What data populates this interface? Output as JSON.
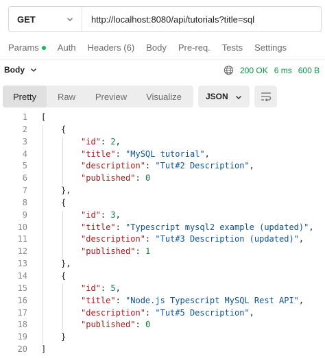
{
  "request": {
    "method": "GET",
    "url": "http://localhost:8080/api/tutorials?title=sql"
  },
  "request_tabs": [
    {
      "label": "Params",
      "indicator": true
    },
    {
      "label": "Auth"
    },
    {
      "label": "Headers (6)"
    },
    {
      "label": "Body"
    },
    {
      "label": "Pre-req."
    },
    {
      "label": "Tests"
    },
    {
      "label": "Settings"
    }
  ],
  "response": {
    "section_label": "Body",
    "status": "200 OK",
    "time": "6 ms",
    "size": "600 B"
  },
  "format_tabs": [
    "Pretty",
    "Raw",
    "Preview",
    "Visualize"
  ],
  "active_format": "Pretty",
  "language": "JSON",
  "colors": {
    "key": "#a41a1a",
    "string": "#0b5394",
    "number": "#11783f",
    "status_ok": "#0b8f47",
    "params_dot": "#0cbb52"
  },
  "json_lines": [
    {
      "n": "1",
      "indent": 0,
      "parts": [
        {
          "t": "[",
          "c": "pun"
        }
      ]
    },
    {
      "n": "2",
      "indent": 1,
      "parts": [
        {
          "t": "{",
          "c": "pun"
        }
      ]
    },
    {
      "n": "3",
      "indent": 2,
      "parts": [
        {
          "t": "\"id\"",
          "c": "key"
        },
        {
          "t": ": ",
          "c": "pun"
        },
        {
          "t": "2",
          "c": "num"
        },
        {
          "t": ",",
          "c": "pun"
        }
      ]
    },
    {
      "n": "4",
      "indent": 2,
      "parts": [
        {
          "t": "\"title\"",
          "c": "key"
        },
        {
          "t": ": ",
          "c": "pun"
        },
        {
          "t": "\"MySQL tutorial\"",
          "c": "str"
        },
        {
          "t": ",",
          "c": "pun"
        }
      ]
    },
    {
      "n": "5",
      "indent": 2,
      "parts": [
        {
          "t": "\"description\"",
          "c": "key"
        },
        {
          "t": ": ",
          "c": "pun"
        },
        {
          "t": "\"Tut#2 Description\"",
          "c": "str"
        },
        {
          "t": ",",
          "c": "pun"
        }
      ]
    },
    {
      "n": "6",
      "indent": 2,
      "parts": [
        {
          "t": "\"published\"",
          "c": "key"
        },
        {
          "t": ": ",
          "c": "pun"
        },
        {
          "t": "0",
          "c": "num"
        }
      ]
    },
    {
      "n": "7",
      "indent": 1,
      "parts": [
        {
          "t": "},",
          "c": "pun"
        }
      ]
    },
    {
      "n": "8",
      "indent": 1,
      "parts": [
        {
          "t": "{",
          "c": "pun"
        }
      ]
    },
    {
      "n": "9",
      "indent": 2,
      "parts": [
        {
          "t": "\"id\"",
          "c": "key"
        },
        {
          "t": ": ",
          "c": "pun"
        },
        {
          "t": "3",
          "c": "num"
        },
        {
          "t": ",",
          "c": "pun"
        }
      ]
    },
    {
      "n": "10",
      "indent": 2,
      "parts": [
        {
          "t": "\"title\"",
          "c": "key"
        },
        {
          "t": ": ",
          "c": "pun"
        },
        {
          "t": "\"Typescript mysql2 example (updated)\"",
          "c": "str"
        },
        {
          "t": ",",
          "c": "pun"
        }
      ]
    },
    {
      "n": "11",
      "indent": 2,
      "parts": [
        {
          "t": "\"description\"",
          "c": "key"
        },
        {
          "t": ": ",
          "c": "pun"
        },
        {
          "t": "\"Tut#3 Description (updated)\"",
          "c": "str"
        },
        {
          "t": ",",
          "c": "pun"
        }
      ]
    },
    {
      "n": "12",
      "indent": 2,
      "parts": [
        {
          "t": "\"published\"",
          "c": "key"
        },
        {
          "t": ": ",
          "c": "pun"
        },
        {
          "t": "1",
          "c": "num"
        }
      ]
    },
    {
      "n": "13",
      "indent": 1,
      "parts": [
        {
          "t": "},",
          "c": "pun"
        }
      ]
    },
    {
      "n": "14",
      "indent": 1,
      "parts": [
        {
          "t": "{",
          "c": "pun"
        }
      ]
    },
    {
      "n": "15",
      "indent": 2,
      "parts": [
        {
          "t": "\"id\"",
          "c": "key"
        },
        {
          "t": ": ",
          "c": "pun"
        },
        {
          "t": "5",
          "c": "num"
        },
        {
          "t": ",",
          "c": "pun"
        }
      ]
    },
    {
      "n": "16",
      "indent": 2,
      "parts": [
        {
          "t": "\"title\"",
          "c": "key"
        },
        {
          "t": ": ",
          "c": "pun"
        },
        {
          "t": "\"Node.js Typescript MySQL Rest API\"",
          "c": "str"
        },
        {
          "t": ",",
          "c": "pun"
        }
      ]
    },
    {
      "n": "17",
      "indent": 2,
      "parts": [
        {
          "t": "\"description\"",
          "c": "key"
        },
        {
          "t": ": ",
          "c": "pun"
        },
        {
          "t": "\"Tut#5 Description\"",
          "c": "str"
        },
        {
          "t": ",",
          "c": "pun"
        }
      ]
    },
    {
      "n": "18",
      "indent": 2,
      "parts": [
        {
          "t": "\"published\"",
          "c": "key"
        },
        {
          "t": ": ",
          "c": "pun"
        },
        {
          "t": "0",
          "c": "num"
        }
      ]
    },
    {
      "n": "19",
      "indent": 1,
      "parts": [
        {
          "t": "}",
          "c": "pun"
        }
      ]
    },
    {
      "n": "20",
      "indent": 0,
      "parts": [
        {
          "t": "]",
          "c": "pun"
        }
      ]
    }
  ]
}
